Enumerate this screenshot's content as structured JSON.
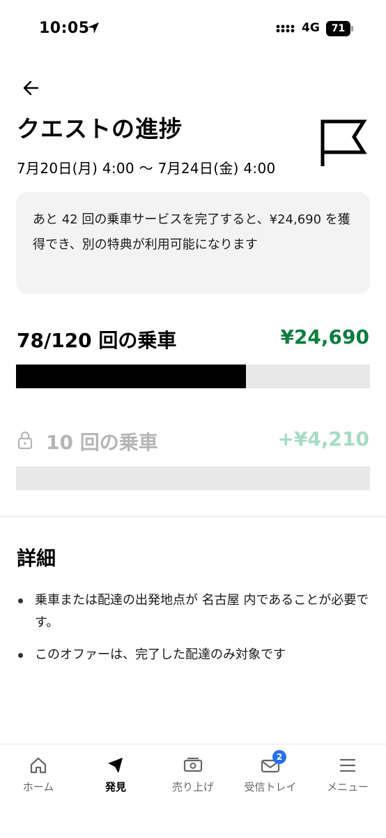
{
  "status_bar": {
    "time": "10:05",
    "network": "4G",
    "battery": "71"
  },
  "header": {
    "title": "クエストの進捗",
    "date_range": "7月20日(月) 4:00 〜 7月24日(金) 4:00"
  },
  "info_card": {
    "message": "あと 42 回の乗車サービスを完了すると、¥24,690 を獲得でき、別の特典が利用可能になります"
  },
  "progress": {
    "label": "78/120 回の乗車",
    "amount": "¥24,690",
    "current": 78,
    "total": 120
  },
  "locked_tier": {
    "label": "10 回の乗車",
    "amount": "+¥4,210",
    "fill_fraction": 0
  },
  "details": {
    "title": "詳細",
    "items": [
      "乗車または配達の出発地点が 名古屋 内であることが必要です。",
      "このオファーは、完了した配達のみ対象です"
    ]
  },
  "bottom_nav": {
    "items": [
      {
        "label": "ホーム",
        "icon": "home-icon"
      },
      {
        "label": "発見",
        "icon": "compass-icon",
        "active": true
      },
      {
        "label": "売り上げ",
        "icon": "earnings-icon"
      },
      {
        "label": "受信トレイ",
        "icon": "inbox-icon",
        "badge": "2"
      },
      {
        "label": "メニュー",
        "icon": "menu-icon"
      }
    ]
  },
  "colors": {
    "accent_green": "#0b7d3e",
    "locked_green": "#a6dcc4",
    "badge_blue": "#276ef1"
  }
}
